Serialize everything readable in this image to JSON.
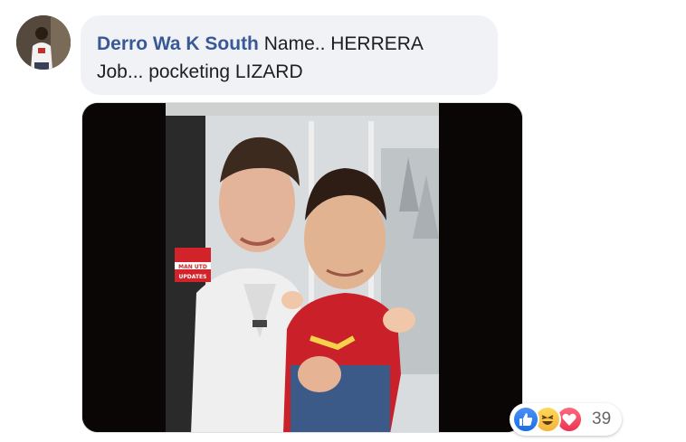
{
  "comment": {
    "author": "Derro Wa K South",
    "line1": "Name.. HERRERA",
    "line2": "Job... pocketing LIZARD"
  },
  "image": {
    "logo_text_top": "MAN UTD",
    "logo_text_bottom": "UPDATES"
  },
  "reactions": {
    "icons": [
      "like-icon",
      "haha-icon",
      "love-icon"
    ],
    "count": "39",
    "colors": {
      "like": "#1a6ee8",
      "haha": "#f4b33a",
      "love": "#ec3350"
    }
  },
  "colors": {
    "author_link": "#385898",
    "bubble_bg": "#f0f2f5",
    "text": "#1c1e21"
  }
}
